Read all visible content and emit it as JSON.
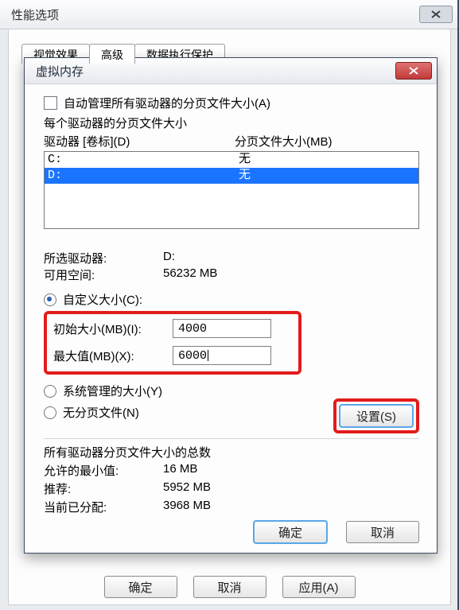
{
  "outer": {
    "title": "性能选项",
    "tabs": [
      "视觉效果",
      "高级",
      "数据执行保护"
    ],
    "active_tab_index": 1,
    "buttons": {
      "ok": "确定",
      "cancel": "取消",
      "apply": "应用(A)"
    }
  },
  "dialog": {
    "title": "虚拟内存",
    "auto_manage_label": "自动管理所有驱动器的分页文件大小(A)",
    "auto_manage_checked": false,
    "per_drive_label": "每个驱动器的分页文件大小",
    "col_drive": "驱动器 [卷标](D)",
    "col_size": "分页文件大小(MB)",
    "drives": [
      {
        "letter": "C:",
        "size": "无",
        "selected": false
      },
      {
        "letter": "D:",
        "size": "无",
        "selected": true
      }
    ],
    "selected_drive_label": "所选驱动器:",
    "selected_drive_value": "D:",
    "free_space_label": "可用空间:",
    "free_space_value": "56232 MB",
    "size_mode": "custom",
    "custom_label": "自定义大小(C):",
    "initial_label": "初始大小(MB)(I):",
    "initial_value": "4000",
    "max_label": "最大值(MB)(X):",
    "max_value": "6000",
    "system_managed_label": "系统管理的大小(Y)",
    "no_paging_label": "无分页文件(N)",
    "set_button": "设置(S)",
    "totals_header": "所有驱动器分页文件大小的总数",
    "min_allowed_label": "允许的最小值:",
    "min_allowed_value": "16 MB",
    "recommended_label": "推荐:",
    "recommended_value": "5952 MB",
    "allocated_label": "当前已分配:",
    "allocated_value": "3968 MB",
    "ok": "确定",
    "cancel": "取消"
  }
}
